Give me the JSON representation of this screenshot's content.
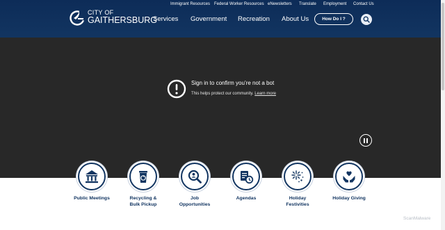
{
  "header": {
    "utility_links": [
      "Immigrant Resources",
      "Federal Worker Resources",
      "eNewsletters",
      "Translate",
      "Employment",
      "Contact Us"
    ],
    "logo": {
      "line1": "CITY OF",
      "line2": "GAITHERSBURG"
    },
    "nav": [
      "Services",
      "Government",
      "Recreation",
      "About Us"
    ],
    "how_do_i": "How Do I ?",
    "search_icon": "search-icon"
  },
  "hero": {
    "title": "Sign in to confirm you’re not a bot",
    "subtitle": "This helps protect our community.",
    "learn_more": "Learn more",
    "alert_icon": "exclamation-circle-icon",
    "pause_icon": "pause-icon"
  },
  "quick_links": [
    {
      "label": "Public Meetings",
      "icon": "building-icon"
    },
    {
      "label": "Recycling &\nBulk Pickup",
      "icon": "recycling-bin-icon"
    },
    {
      "label": "Job\nOpportunities",
      "icon": "magnifier-person-icon"
    },
    {
      "label": "Agendas",
      "icon": "documents-clock-icon"
    },
    {
      "label": "Holiday\nFestivities",
      "icon": "fireworks-icon"
    },
    {
      "label": "Holiday Giving",
      "icon": "hands-heart-icon"
    }
  ],
  "watermark": "ScanMalware",
  "colors": {
    "navy": "#123561",
    "hero_bg": "#282828"
  }
}
